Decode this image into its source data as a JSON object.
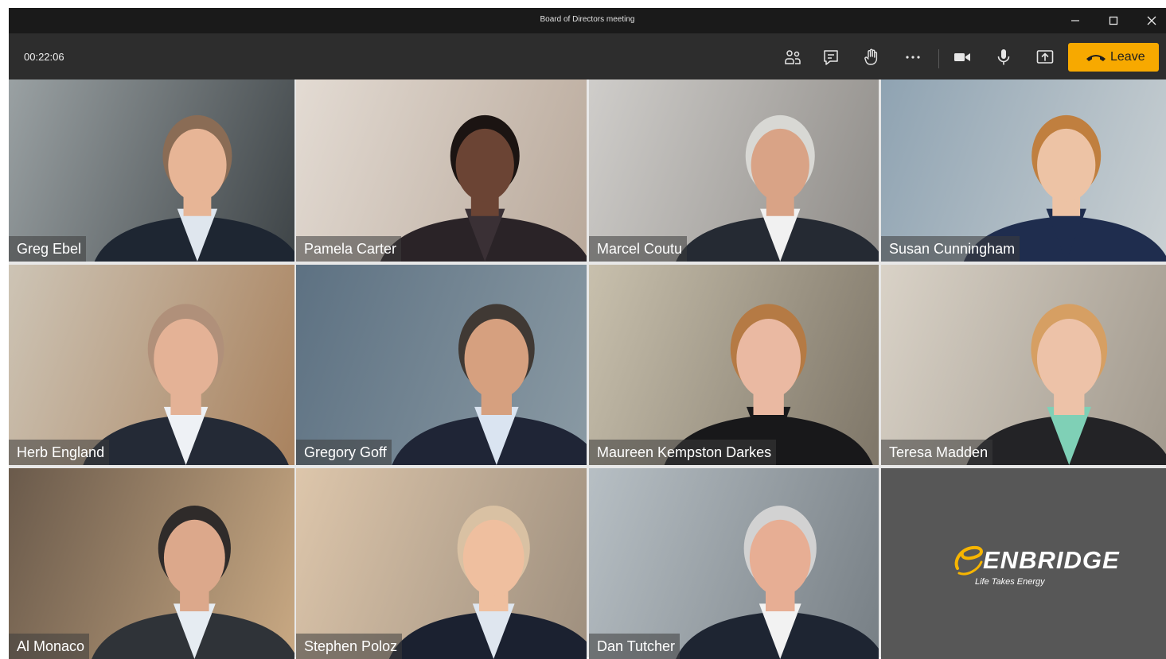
{
  "window": {
    "title": "Board of Directors meeting"
  },
  "toolbar": {
    "timer": "00:22:06",
    "icons": [
      "participants-icon",
      "chat-icon",
      "raise-hand-icon",
      "more-options-icon",
      "camera-icon",
      "microphone-icon",
      "share-screen-icon"
    ],
    "leave_label": "Leave",
    "leave_color": "#f7a900"
  },
  "participants": [
    {
      "name": "Greg Ebel"
    },
    {
      "name": "Pamela Carter"
    },
    {
      "name": "Marcel Coutu"
    },
    {
      "name": "Susan Cunningham"
    },
    {
      "name": "Herb England"
    },
    {
      "name": "Gregory Goff"
    },
    {
      "name": "Maureen Kempston Darkes"
    },
    {
      "name": "Teresa Madden"
    },
    {
      "name": "Al Monaco"
    },
    {
      "name": "Stephen Poloz"
    },
    {
      "name": "Dan Tutcher"
    }
  ],
  "brand": {
    "wordmark": "ENBRIDGE",
    "tagline": "Life Takes Energy",
    "accent": "#f7b500",
    "tile_color": "#575757"
  }
}
